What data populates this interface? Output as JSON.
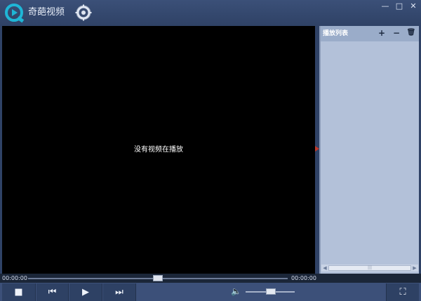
{
  "app": {
    "title": "奇葩视频",
    "logo_icon": "play-logo-icon",
    "settings_icon": "gear-icon"
  },
  "window_controls": {
    "minimize": "—",
    "maximize": "□",
    "close": "✕"
  },
  "video": {
    "message": "没有视频在播放"
  },
  "playlist": {
    "title": "播放列表",
    "add": "+",
    "remove": "−",
    "clear_icon": "trash-icon",
    "clear": "🗑",
    "scroll_left": "◀",
    "scroll_right": "▶",
    "scroll_grip": "|||",
    "items": []
  },
  "seek": {
    "current": "00:00:00",
    "total": "00:00:00"
  },
  "controls": {
    "stop": "■",
    "previous": "⏮",
    "play": "▶",
    "next": "⏭",
    "volume": "🔈",
    "fullscreen": "⛶"
  },
  "colors": {
    "titlebar": "#2f4266",
    "video_bg": "#000000",
    "playlist_bg": "#b3c1d9",
    "accent_arrow": "#c0392b",
    "logo": "#1fb6d6"
  }
}
